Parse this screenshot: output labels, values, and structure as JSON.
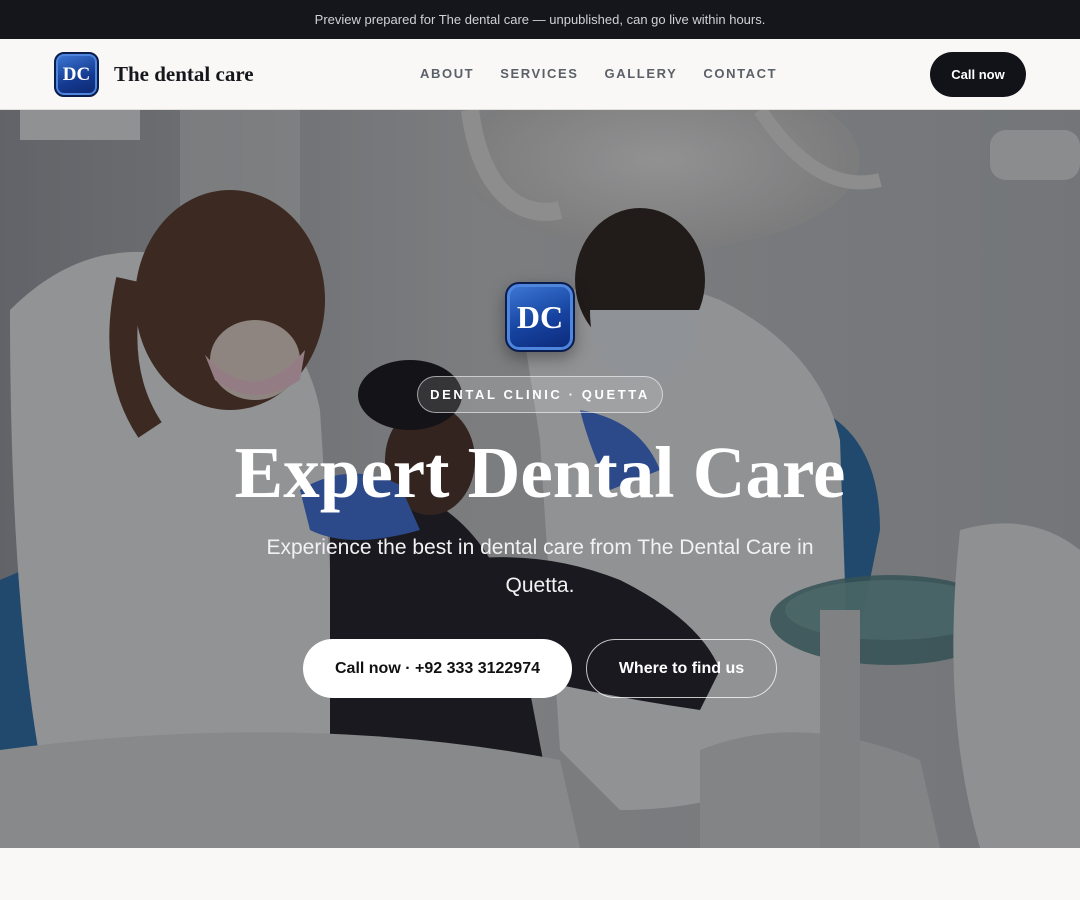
{
  "announcement": {
    "text": "Preview prepared for The dental care — unpublished, can go live within hours."
  },
  "header": {
    "logo_initials": "DC",
    "brand_name": "The dental care",
    "nav": [
      {
        "label": "ABOUT"
      },
      {
        "label": "SERVICES"
      },
      {
        "label": "GALLERY"
      },
      {
        "label": "CONTACT"
      }
    ],
    "cta_label": "Call now"
  },
  "hero": {
    "background": "photo of dentists treating a patient in a dental chair",
    "logo_initials": "DC",
    "badge": "DENTAL CLINIC · QUETTA",
    "title": "Expert Dental Care",
    "subtitle": "Experience the best in dental care from The Dental Care in Quetta.",
    "primary_button": "Call now · +92 333 3122974",
    "secondary_button": "Where to find us"
  },
  "colors": {
    "topbar": "#14161b",
    "accent_dark": "#121318",
    "logo_blue": "#1643a0",
    "page_bg": "#f9f8f6"
  }
}
